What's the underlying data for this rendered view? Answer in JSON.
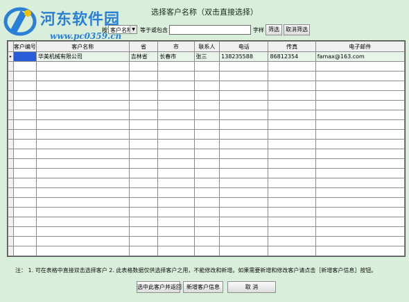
{
  "window": {
    "title": "选择客户名称（双击直接选择）"
  },
  "watermark": {
    "name": "河东软件园",
    "url": "www.pc0359.cn"
  },
  "filter": {
    "prefix_label": "按",
    "field_selected": "客户名称",
    "operator_label": "等于或包含",
    "keyword_value": "",
    "suffix_label": "字样",
    "filter_button": "筛选",
    "cancel_filter_button": "取消筛选"
  },
  "table": {
    "columns": [
      "",
      "客户编号",
      "客户名称",
      "省",
      "市",
      "联系人",
      "电话",
      "传真",
      "电子邮件"
    ],
    "rows": [
      [
        "▸",
        "",
        "华美机械有限公司",
        "吉林省",
        "长春市",
        "张三",
        "138235588",
        "86812354",
        "famax@163.com"
      ]
    ],
    "empty_row_count": 20
  },
  "note": "注：  1. 可在表格中直接双击选择客户   2. 此表格数据仅供选择客户之用，不能修改和新增。如果需要新增和修改客户请点击［新增客户信息］按钮。",
  "buttons": {
    "select_return": "选中此客户并返回",
    "add_customer": "新增客户信息",
    "cancel": "取 消"
  },
  "colors": {
    "background": "#d9eedb",
    "selection": "#2a5bd8",
    "watermark": "#2a7fd6"
  }
}
